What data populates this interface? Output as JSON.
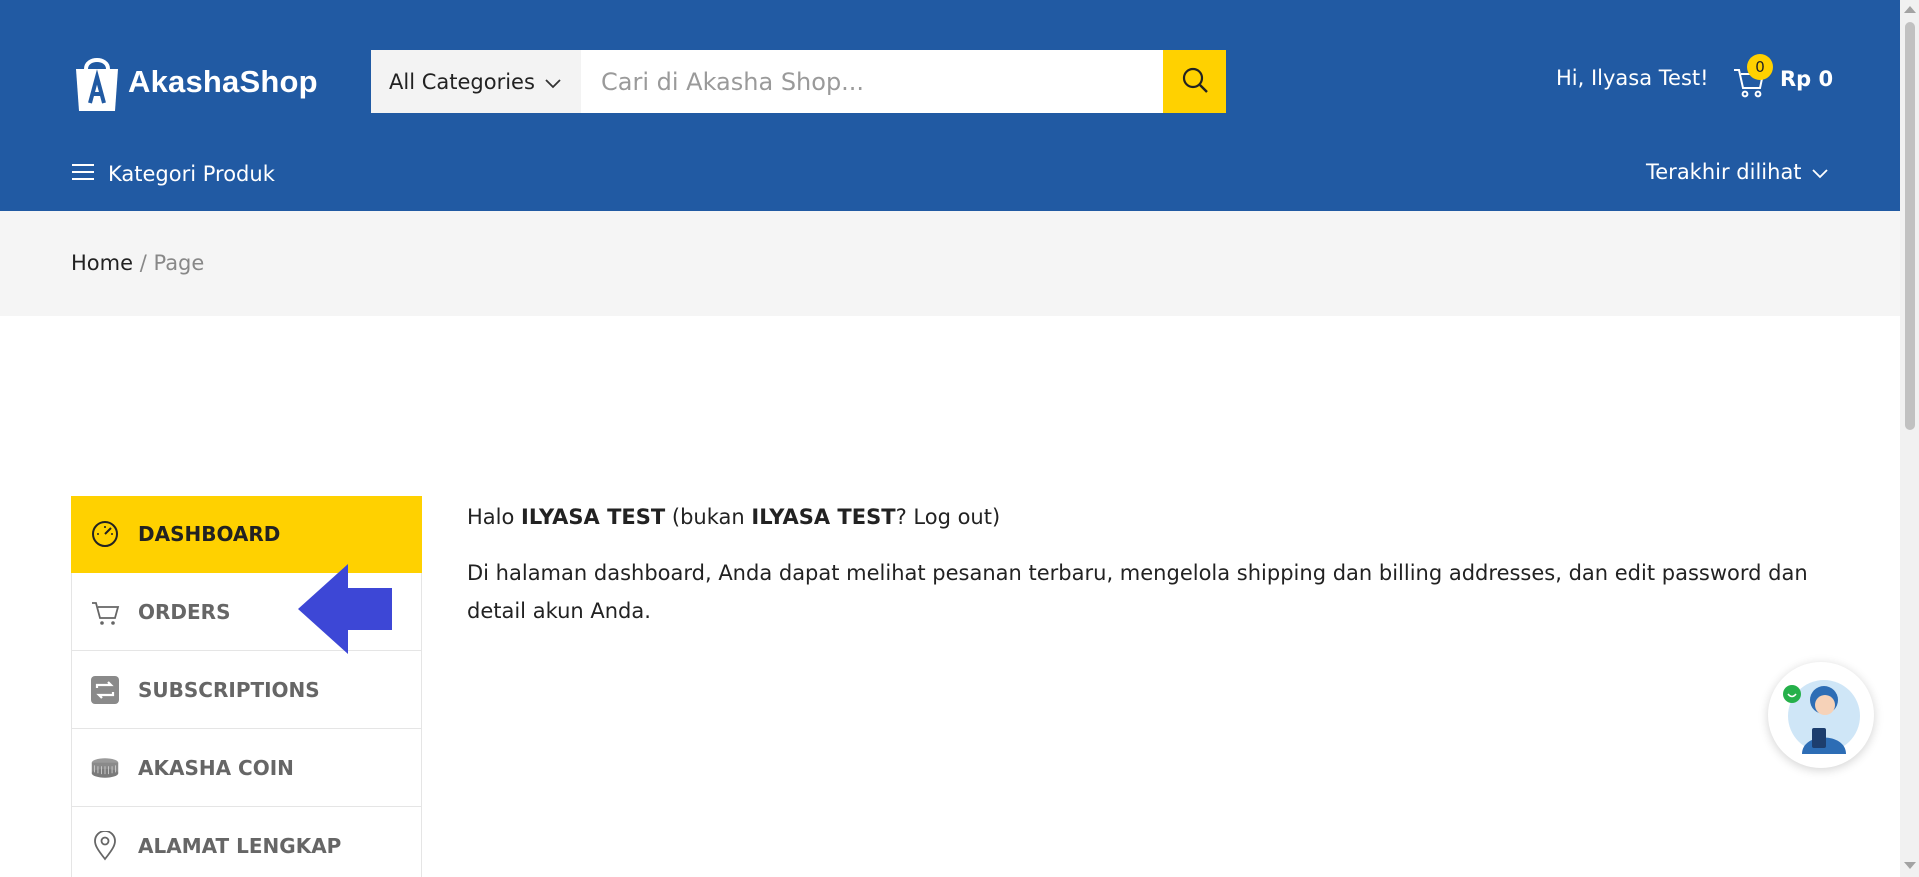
{
  "brand": {
    "name": "AkashaShop",
    "header_color": "#215aa3",
    "accent_color": "#ffd100"
  },
  "search": {
    "category_label": "All Categories",
    "placeholder": "Cari di Akasha Shop..."
  },
  "user": {
    "greeting": "Hi, Ilyasa Test!"
  },
  "cart": {
    "count": "0",
    "total": "Rp 0"
  },
  "nav": {
    "kategori_label": "Kategori Produk",
    "recent_label": "Terakhir dilihat"
  },
  "breadcrumb": {
    "home": "Home",
    "separator": "/",
    "current": "Page"
  },
  "menu": {
    "items": [
      {
        "label": "DASHBOARD",
        "icon": "gauge-icon",
        "active": true
      },
      {
        "label": "ORDERS",
        "icon": "cart-icon",
        "active": false
      },
      {
        "label": "SUBSCRIPTIONS",
        "icon": "repeat-icon",
        "active": false
      },
      {
        "label": "AKASHA COIN",
        "icon": "coin-stack-icon",
        "active": false
      },
      {
        "label": "ALAMAT LENGKAP",
        "icon": "location-pin-icon",
        "active": false
      }
    ]
  },
  "content": {
    "hello_prefix": "Halo ",
    "username": "ILYASA TEST",
    "paren_prefix": " (bukan ",
    "username_repeat": "ILYASA TEST",
    "question": "? ",
    "logout": "Log out",
    "paren_close": ")",
    "description": "Di halaman dashboard, Anda dapat melihat pesanan terbaru, mengelola shipping dan billing addresses, dan edit password dan detail akun Anda."
  }
}
